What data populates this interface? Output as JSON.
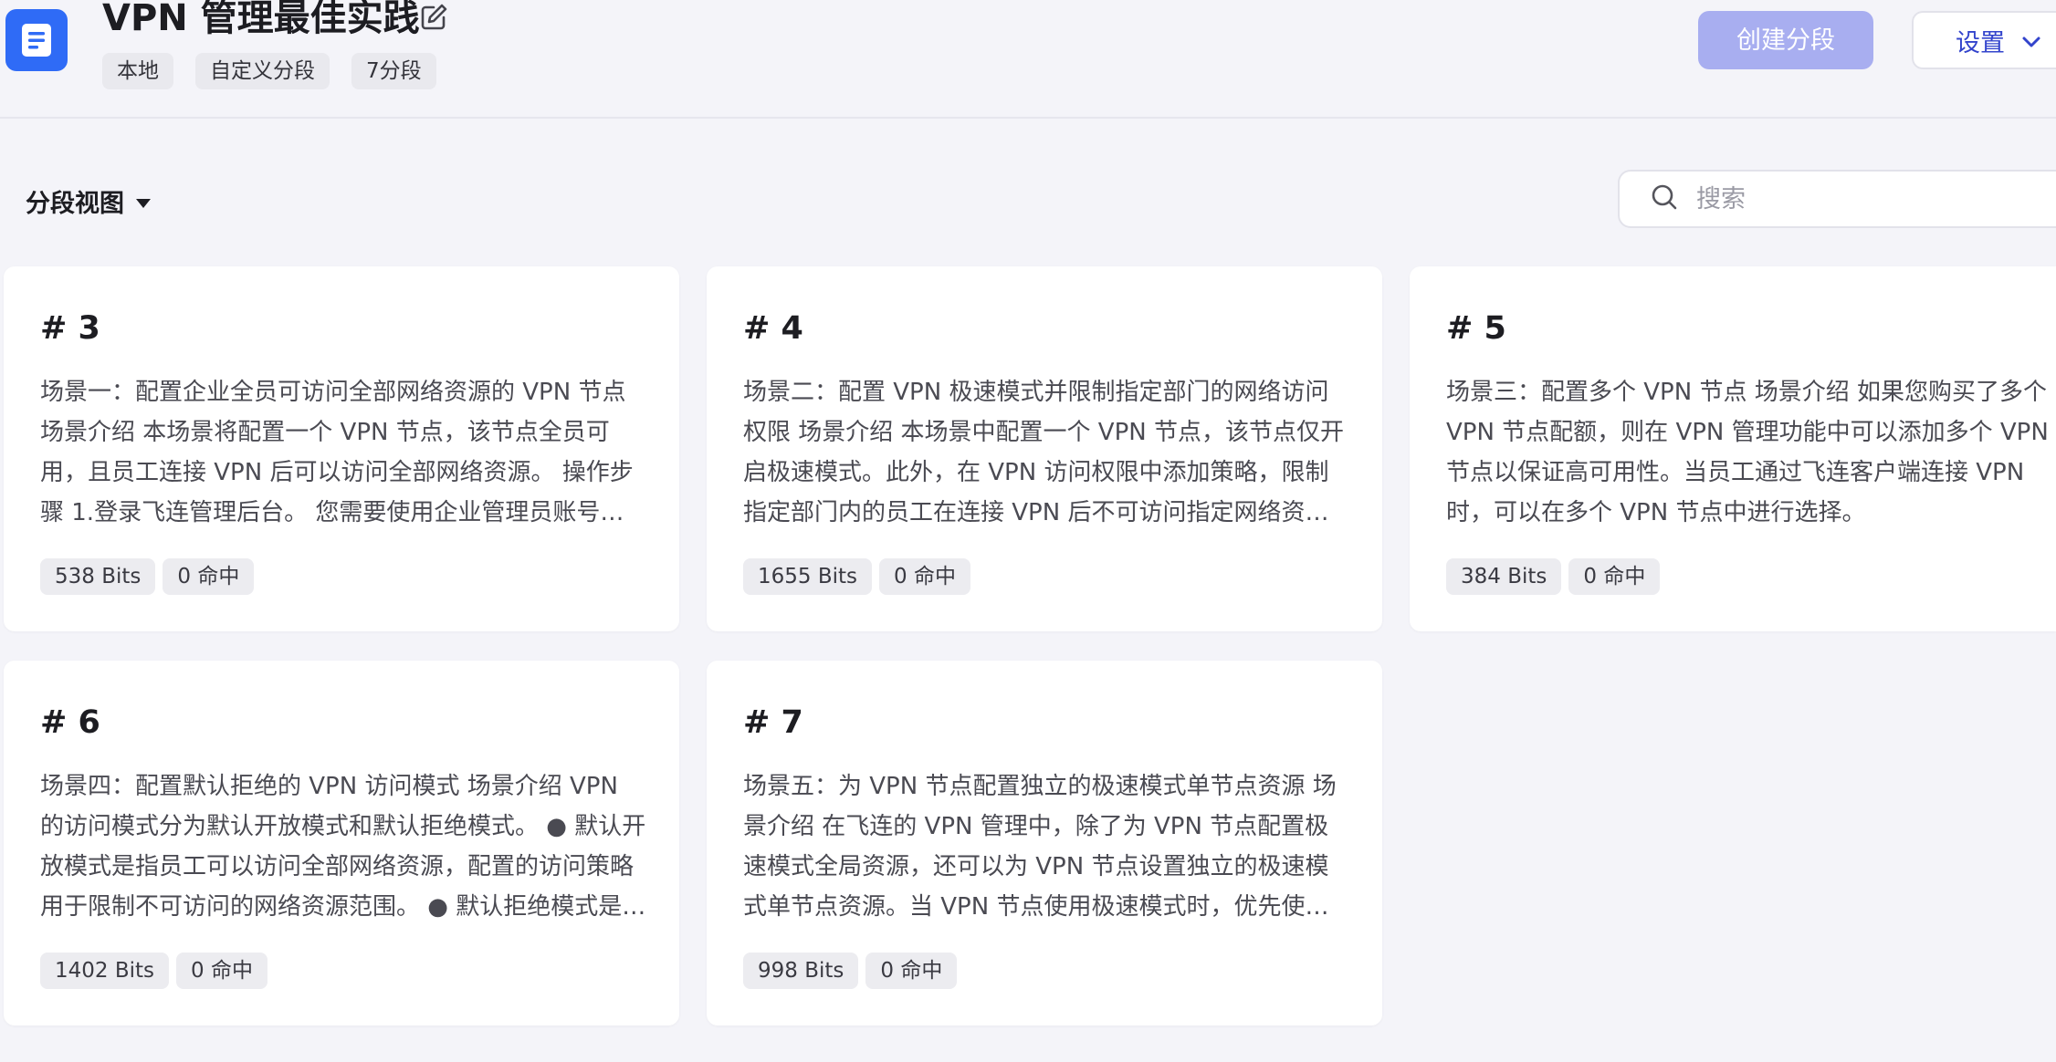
{
  "header": {
    "title": "VPN 管理最佳实践",
    "tags": [
      "本地",
      "自定义分段",
      "7分段"
    ],
    "create_button": "创建分段",
    "settings_button": "设置"
  },
  "toolbar": {
    "view_label": "分段视图",
    "search_placeholder": "搜索"
  },
  "colors": {
    "accent": "#2f6bf6",
    "create_button_bg": "#a8aef0",
    "settings_text": "#3344cc",
    "page_bg": "#f4f4f9"
  },
  "icons": [
    "doc-icon",
    "edit-icon",
    "chevron-down-icon",
    "caret-down-icon",
    "search-icon"
  ],
  "cards": [
    {
      "id": "# 3",
      "text": "场景一：配置企业全员可访问全部网络资源的 VPN 节点 场景介绍 本场景将配置一个 VPN 节点，该节点全员可用，且员工连接 VPN 后可以访问全部网络资源。 操作步骤 1.登录飞连管理后台。 您需要使用企业管理员账号登录飞连管理后台。",
      "bits": "538 Bits",
      "hits": "0 命中"
    },
    {
      "id": "# 4",
      "text": "场景二：配置 VPN 极速模式并限制指定部门的网络访问权限 场景介绍 本场景中配置一个 VPN 节点，该节点仅开启极速模式。此外，在 VPN 访问权限中添加策略，限制指定部门内的员工在连接 VPN 后不可访问指定网络资源。",
      "bits": "1655 Bits",
      "hits": "0 命中"
    },
    {
      "id": "# 5",
      "text": "场景三：配置多个 VPN 节点 场景介绍 如果您购买了多个 VPN 节点配额，则在 VPN 管理功能中可以添加多个 VPN 节点以保证高可用性。当员工通过飞连客户端连接 VPN 时，可以在多个 VPN 节点中进行选择。",
      "bits": "384 Bits",
      "hits": "0 命中"
    },
    {
      "id": "# 6",
      "text": "场景四：配置默认拒绝的 VPN 访问模式 场景介绍 VPN 的访问模式分为默认开放模式和默认拒绝模式。 ● 默认开放模式是指员工可以访问全部网络资源，配置的访问策略用于限制不可访问的网络资源范围。 ● 默认拒绝模式是指员工默认无法访问网络资源。",
      "bits": "1402 Bits",
      "hits": "0 命中"
    },
    {
      "id": "# 7",
      "text": "场景五：为 VPN 节点配置独立的极速模式单节点资源 场景介绍 在飞连的 VPN 管理中，除了为 VPN 节点配置极速模式全局资源，还可以为 VPN 节点设置独立的极速模式单节点资源。当 VPN 节点使用极速模式时，优先使用单节点资源。",
      "bits": "998 Bits",
      "hits": "0 命中"
    }
  ]
}
